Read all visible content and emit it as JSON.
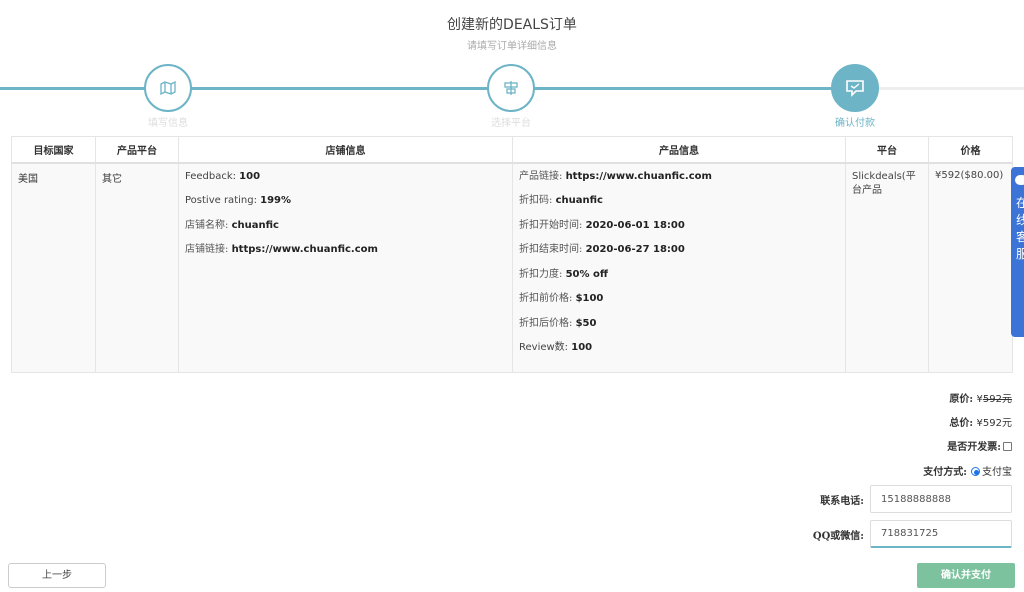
{
  "header": {
    "title": "创建新的DEALS订单",
    "subtitle": "请填写订单详细信息"
  },
  "steps": [
    {
      "label": "填写信息",
      "icon": "map-icon",
      "state": "done"
    },
    {
      "label": "选择平台",
      "icon": "align-icon",
      "state": "done"
    },
    {
      "label": "确认付款",
      "icon": "chat-icon",
      "state": "active"
    }
  ],
  "colors": {
    "accent": "#6cb4c6",
    "confirm": "#7cc29e",
    "sidetab": "#3b73d6"
  },
  "table": {
    "headers": [
      "目标国家",
      "产品平台",
      "店铺信息",
      "产品信息",
      "平台",
      "价格"
    ],
    "row": {
      "country": "美国",
      "platform": "其它",
      "store": [
        {
          "k": "Feedback: ",
          "v": "100"
        },
        {
          "k": "Postive rating: ",
          "v": "199%"
        },
        {
          "k": "店铺名称: ",
          "v": "chuanfic"
        },
        {
          "k": "店铺链接: ",
          "v": "https://www.chuanfic.com"
        }
      ],
      "product": [
        {
          "k": "产品链接: ",
          "v": "https://www.chuanfic.com"
        },
        {
          "k": "折扣码: ",
          "v": "chuanfic"
        },
        {
          "k": "折扣开始时间: ",
          "v": "2020-06-01 18:00"
        },
        {
          "k": "折扣结束时间: ",
          "v": "2020-06-27 18:00"
        },
        {
          "k": "折扣力度: ",
          "v": "50% off"
        },
        {
          "k": "折扣前价格: ",
          "v": "$100"
        },
        {
          "k": "折扣后价格: ",
          "v": "$50"
        },
        {
          "k": "Review数: ",
          "v": "100"
        }
      ],
      "deal_platform": "Slickdeals(平台产品",
      "price": "¥592($80.00)"
    }
  },
  "summary": {
    "original_label": "原价: ",
    "original_currency": "¥",
    "original_value": "592",
    "original_unit": "元",
    "total_label": "总价: ",
    "total_value": "¥592元",
    "invoice_label": "是否开发票:",
    "invoice_checked": false,
    "payment_label": "支付方式:",
    "payment_option": "支付宝"
  },
  "contact": {
    "phone_label": "联系电话:",
    "phone_value": "15188888888",
    "qq_label": "QQ或微信:",
    "qq_value": "718831725"
  },
  "buttons": {
    "prev": "上一步",
    "confirm": "确认并支付"
  },
  "side_tab": {
    "text": "在线客服",
    "chars": [
      "在",
      "线",
      "客",
      "服"
    ]
  }
}
